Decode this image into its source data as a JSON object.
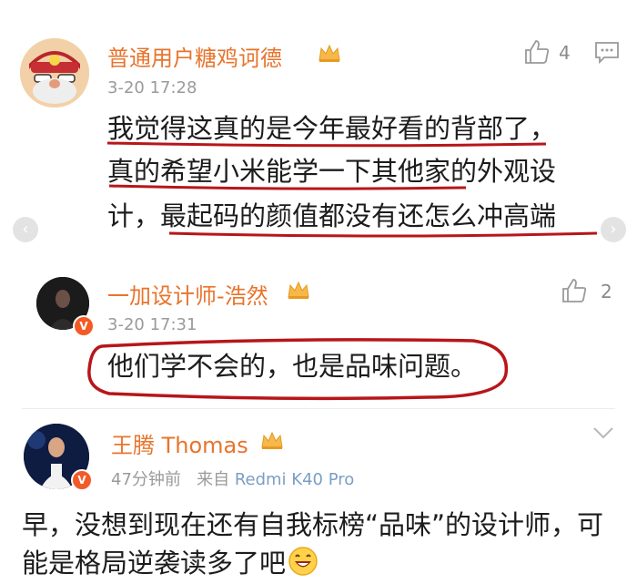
{
  "comments": [
    {
      "username": "普通用户糖鸡诃德",
      "timestamp": "3-20  17:28",
      "likes": "4",
      "lines": [
        "我觉得这真的是今年最好看的背部了，",
        "真的希望小米能学一下其他家的外观设",
        "计，最起码的颜值都没有还怎么冲高端"
      ]
    },
    {
      "username": "一加设计师-浩然",
      "timestamp": "3-20  17:31",
      "likes": "2",
      "text": "他们学不会的，也是品味问题。",
      "verified_badge": "V"
    },
    {
      "username": "王腾 Thomas",
      "timestamp": "47分钟前",
      "source_prefix": "来自",
      "source_device": "Redmi K40 Pro",
      "lines": [
        "早，没想到现在还有自我标榜“品味”的设计师，可",
        "能是格局逆袭读多了吧"
      ],
      "verified_badge": "V"
    }
  ],
  "icons": {
    "like": "thumbs-up-icon",
    "comment": "comment-icon",
    "vip": "vip-crown-icon",
    "chevron": "chevron-down-icon",
    "laugh": "laughing-emoji-icon"
  },
  "colors": {
    "username": "#e8742c",
    "annotation_red": "#b7161a",
    "timestamp": "#9a9a9a",
    "source_device": "#7b9ec4"
  }
}
